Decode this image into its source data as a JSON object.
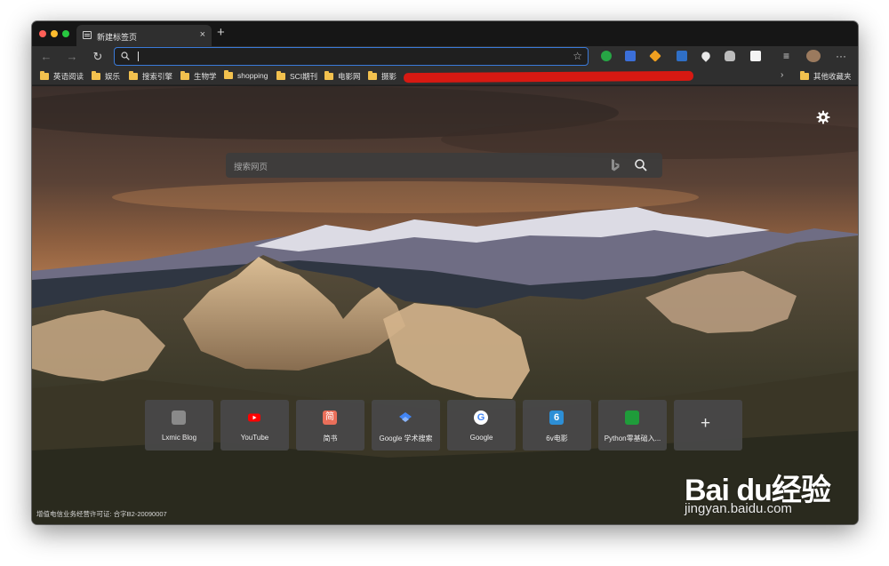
{
  "tab": {
    "title": "新建标签页",
    "close": "×",
    "new_tab": "+"
  },
  "toolbar": {
    "back": "←",
    "forward": "→",
    "reload": "↻",
    "address_value": "",
    "star": "☆",
    "favorites_icon": "≡",
    "more": "···"
  },
  "bookmarks": {
    "items": [
      {
        "label": "英语阅读"
      },
      {
        "label": "娱乐"
      },
      {
        "label": "搜索引擎"
      },
      {
        "label": "生物学"
      },
      {
        "label": "shopping"
      },
      {
        "label": "SCI期刊"
      },
      {
        "label": "电影网"
      },
      {
        "label": "摄影"
      }
    ],
    "more_arrow": "›",
    "other": "其他收藏夹"
  },
  "page": {
    "search_placeholder": "搜索网页",
    "tiles": [
      {
        "label": "Lxmic Blog",
        "icon": "lxmic-icon",
        "color": "#8a8a8a"
      },
      {
        "label": "YouTube",
        "icon": "youtube-icon",
        "color": "#ff0000"
      },
      {
        "label": "简书",
        "icon": "jianshu-icon",
        "color": "#ea6f5a",
        "glyph": "简"
      },
      {
        "label": "Google 学术搜索",
        "icon": "google-scholar-icon",
        "color": "#4285f4"
      },
      {
        "label": "Google",
        "icon": "google-icon",
        "color": "#ffffff",
        "glyph": "G"
      },
      {
        "label": "6v电影",
        "icon": "6v-icon",
        "color": "#2d8fd6",
        "glyph": "6"
      },
      {
        "label": "Python零基础入...",
        "icon": "python-icon",
        "color": "#1f9c3a"
      }
    ],
    "add_tile": "+",
    "footer": "增值电信业务经营许可证: 合字B2-20090007"
  },
  "watermark": {
    "brand": "Bai du经验",
    "url": "jingyan.baidu.com"
  },
  "colors": {
    "accent": "#3a7ad9",
    "redaction": "#d71912",
    "folder": "#f2c14e"
  }
}
